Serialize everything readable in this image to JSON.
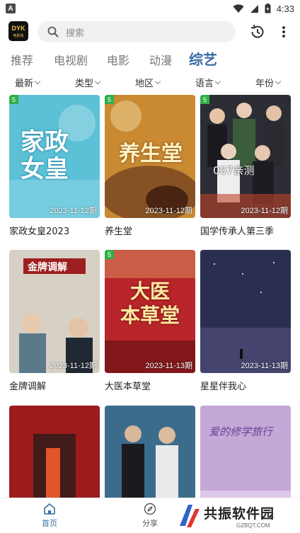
{
  "status_bar": {
    "app_letter": "A",
    "time": "4:33"
  },
  "app_logo": {
    "line1": "DYK",
    "line2": "电影快"
  },
  "search": {
    "placeholder": "搜索"
  },
  "categories": [
    {
      "label": "推荐",
      "active": false
    },
    {
      "label": "电视剧",
      "active": false
    },
    {
      "label": "电影",
      "active": false
    },
    {
      "label": "动漫",
      "active": false
    },
    {
      "label": "综艺",
      "active": true
    }
  ],
  "filters": [
    {
      "label": "最新"
    },
    {
      "label": "类型"
    },
    {
      "label": "地区"
    },
    {
      "label": "语言"
    },
    {
      "label": "年份"
    }
  ],
  "items": [
    {
      "title": "家政女皇2023",
      "period": "2023-11-12期",
      "badge": "5",
      "poster_text": "家政\n女皇"
    },
    {
      "title": "养生堂",
      "period": "2023-11-12期",
      "badge": "5",
      "poster_text": "养生堂"
    },
    {
      "title": "国学传承人第三季",
      "period": "2023-11-12期",
      "badge": "5",
      "poster_text": "007亲测"
    },
    {
      "title": "金牌调解",
      "period": "2023-11-12期",
      "badge": "",
      "poster_text": "金牌调解"
    },
    {
      "title": "大医本草堂",
      "period": "2023-11-13期",
      "badge": "5",
      "poster_text": "大医\n本草堂"
    },
    {
      "title": "星星伴我心",
      "period": "2023-11-13期",
      "badge": "",
      "poster_text": ""
    },
    {
      "title": "",
      "period": "",
      "badge": "",
      "poster_text": ""
    },
    {
      "title": "",
      "period": "",
      "badge": "",
      "poster_text": ""
    },
    {
      "title": "",
      "period": "",
      "badge": "",
      "poster_text": "爱的修学旅行"
    }
  ],
  "poster_colors": [
    "#5cc1d6",
    "#c98a32",
    "#2c2d35",
    "#d7d0c4",
    "#b8252a",
    "#2a2f52",
    "#9e1b1b",
    "#3c6c8c",
    "#c4a8d8"
  ],
  "bottom_nav": [
    {
      "label": "首页",
      "icon": "home-icon",
      "active": true
    },
    {
      "label": "分享",
      "icon": "compass-icon",
      "active": false
    }
  ],
  "watermark": {
    "text": "共振软件园",
    "url": "GZBQT.COM"
  },
  "colors": {
    "accent": "#3a6ea5",
    "badge": "#2fb04a"
  }
}
